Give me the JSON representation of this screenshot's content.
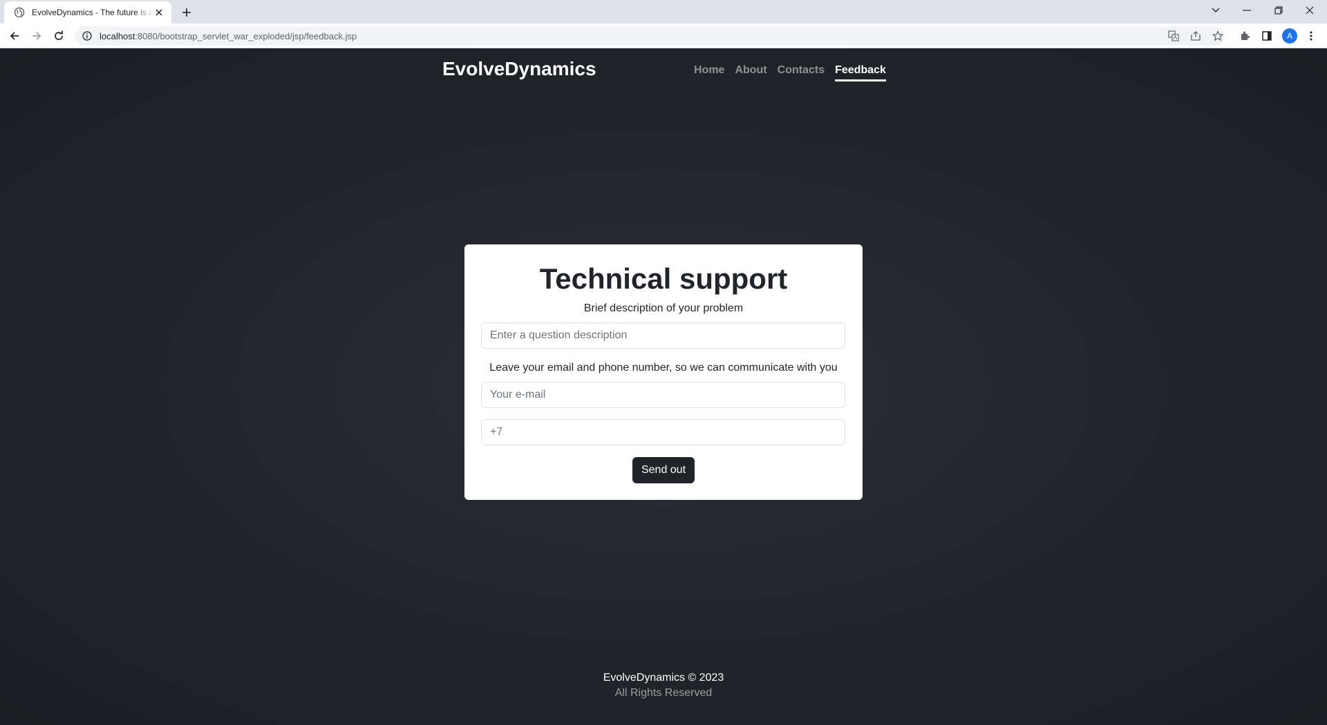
{
  "browser": {
    "tab_title": "EvolveDynamics - The future is already here",
    "url_host": "localhost",
    "url_path": ":8080/bootstrap_servlet_war_exploded/jsp/feedback.jsp",
    "avatar_letter": "A",
    "icons": [
      "globe-icon",
      "close-icon",
      "plus-icon",
      "chevron-down-icon",
      "minimize-icon",
      "restore-icon",
      "window-close-icon",
      "back-icon",
      "forward-icon",
      "reload-icon",
      "info-icon",
      "translate-icon",
      "share-icon",
      "star-icon",
      "extensions-icon",
      "side-panel-icon",
      "more-vert-icon"
    ]
  },
  "header": {
    "brand": "EvolveDynamics",
    "nav": [
      {
        "label": "Home"
      },
      {
        "label": "About"
      },
      {
        "label": "Contacts"
      },
      {
        "label": "Feedback",
        "active": true
      }
    ]
  },
  "form": {
    "title": "Technical support",
    "problem_label": "Brief description of your problem",
    "problem_placeholder": "Enter a question description",
    "contact_label": "Leave your email and phone number, so we can communicate with you",
    "email_placeholder": "Your e-mail",
    "phone_placeholder": "+7",
    "submit_label": "Send out"
  },
  "footer": {
    "copyright": "EvolveDynamics © 2023",
    "rights": "All Rights Reserved"
  },
  "colors": {
    "page_background": "#212529",
    "card_background": "#ffffff",
    "button_background": "#212529",
    "avatar": "#1a73e8"
  }
}
